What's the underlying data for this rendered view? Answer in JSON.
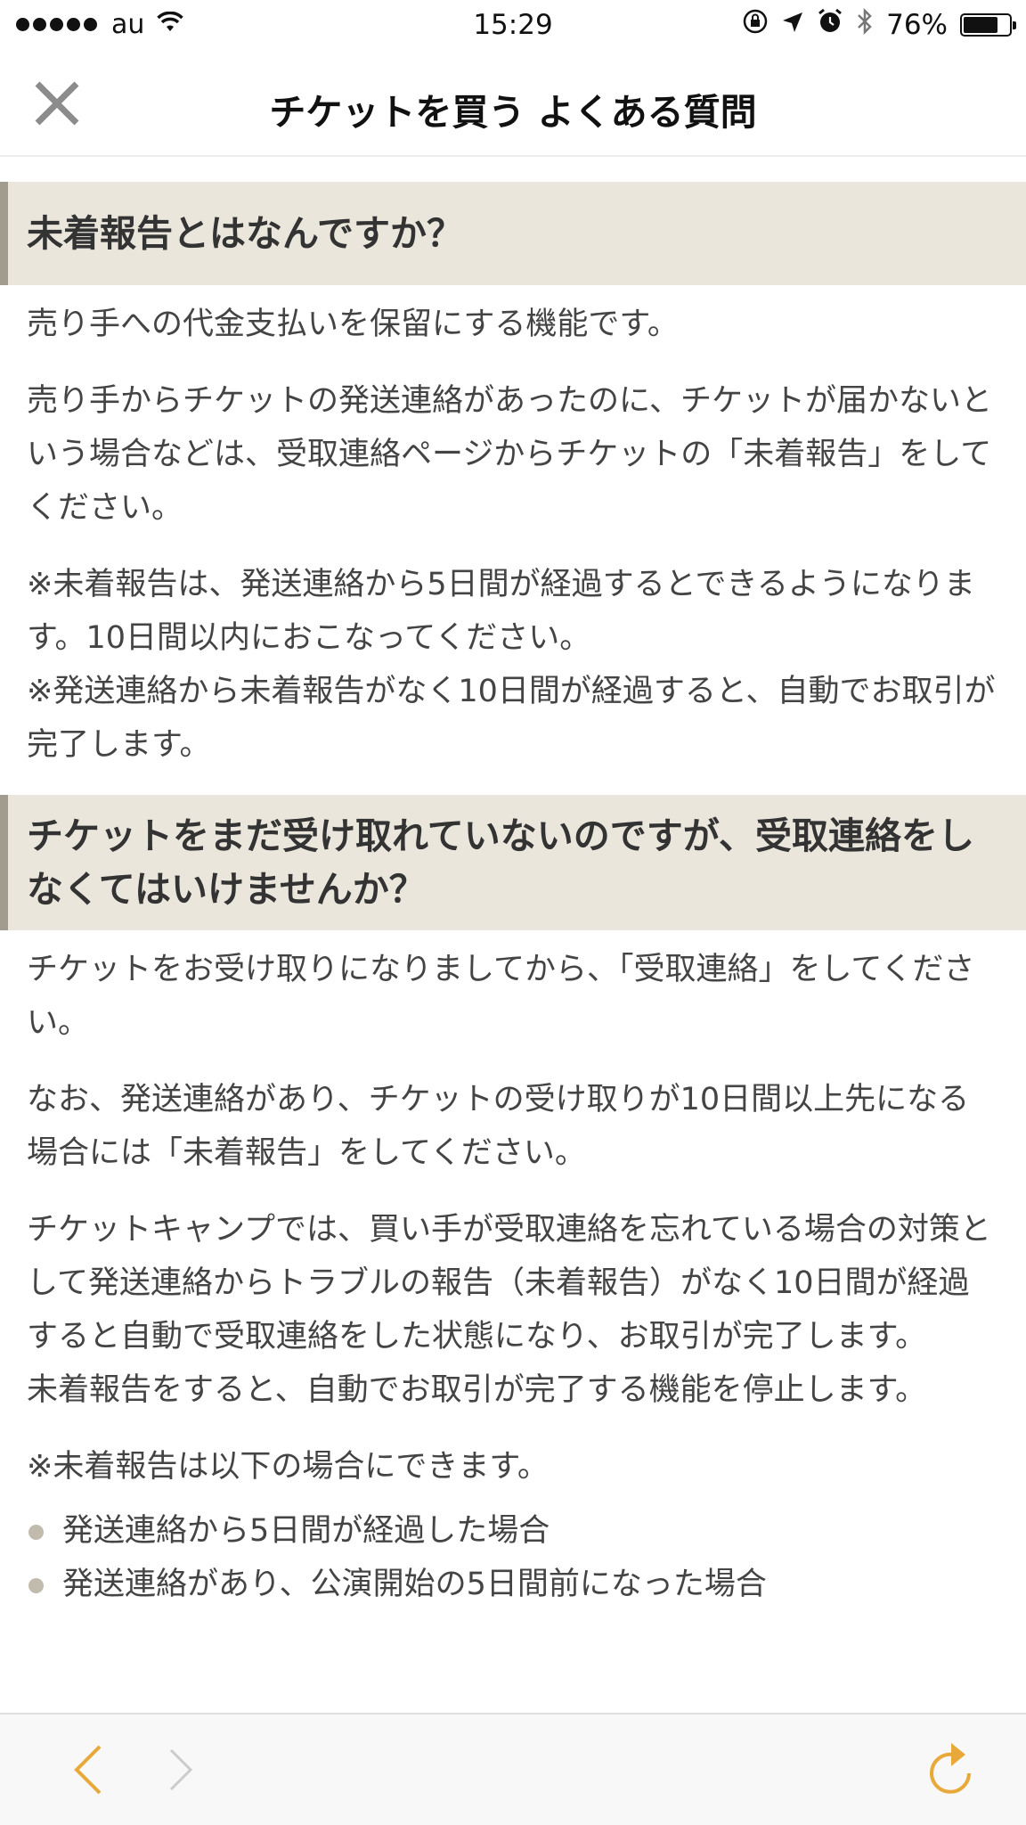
{
  "status_bar": {
    "carrier": "au",
    "time": "15:29",
    "battery_percent": "76%",
    "battery_level": 0.76,
    "icons": [
      "signal-dots-icon",
      "wifi-icon",
      "rotation-lock-icon",
      "location-arrow-icon",
      "alarm-icon",
      "bluetooth-icon",
      "battery-icon"
    ]
  },
  "nav": {
    "title": "チケットを買う よくある質問",
    "close_icon": "close-icon"
  },
  "sections": [
    {
      "heading": "未着報告とはなんですか？",
      "paragraphs": [
        "売り手への代金支払いを保留にする機能です。",
        "売り手からチケットの発送連絡があったのに、チケットが届かないという場合などは、受取連絡ページからチケットの「未着報告」をしてください。",
        "※未着報告は、発送連絡から5日間が経過するとできるようになります。10日間以内におこなってください。\n※発送連絡から未着報告がなく10日間が経過すると、自動でお取引が完了します。"
      ]
    },
    {
      "heading": "チケットをまだ受け取れていないのですが、受取連絡をしなくてはいけませんか？",
      "paragraphs": [
        "チケットをお受け取りになりましてから、「受取連絡」をしてください。",
        "なお、発送連絡があり、チケットの受け取りが10日間以上先になる場合には「未着報告」をしてください。",
        "チケットキャンプでは、買い手が受取連絡を忘れている場合の対策として発送連絡からトラブルの報告（未着報告）がなく10日間が経過すると自動で受取連絡をした状態になり、お取引が完了します。\n未着報告をすると、自動でお取引が完了する機能を停止します。",
        "※未着報告は以下の場合にできます。"
      ],
      "bullets": [
        "発送連絡から5日間が経過した場合",
        "発送連絡があり、公演開始の5日間前になった場合"
      ]
    }
  ],
  "toolbar": {
    "back_icon": "chevron-left-icon",
    "forward_icon": "chevron-right-icon",
    "reload_icon": "reload-icon",
    "accent_color": "#e8a93a",
    "disabled_color": "#cccccc"
  },
  "colors": {
    "header_bg": "#eae6dc",
    "header_border": "#a19c8e",
    "bullet": "#c0bbad"
  }
}
